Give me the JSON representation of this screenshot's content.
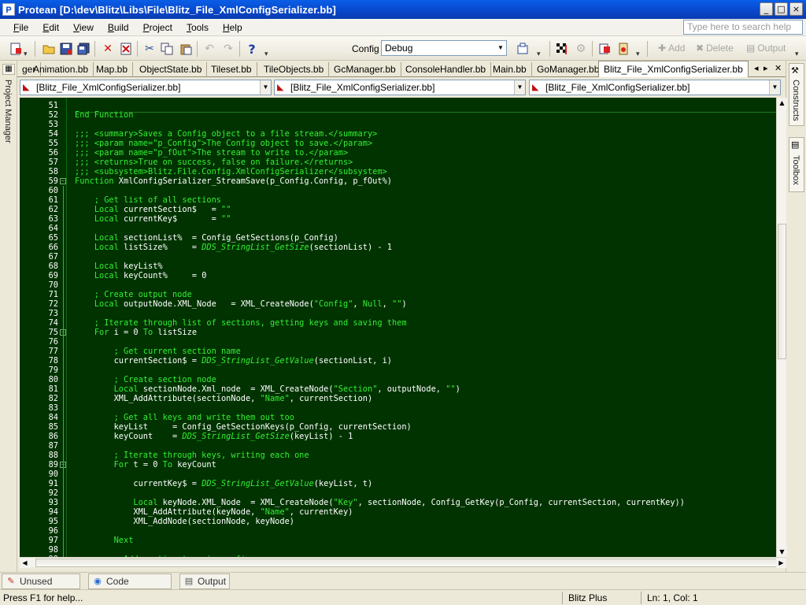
{
  "window": {
    "app_icon": "P",
    "title": "Protean [D:\\dev\\Blitz\\Libs\\File\\Blitz_File_XmlConfigSerializer.bb]",
    "minimize": "_",
    "maximize": "□",
    "close": "×"
  },
  "menu": {
    "items": [
      "File",
      "Edit",
      "View",
      "Build",
      "Project",
      "Tools",
      "Help"
    ],
    "search_placeholder": "Type here to search help"
  },
  "toolbar": {
    "config_label": "Config",
    "config_value": "Debug",
    "add_label": "Add",
    "delete_label": "Delete",
    "output_label": "Output"
  },
  "side": {
    "left_tab": "Project Manager",
    "right_tabs": [
      "Constructs",
      "Toolbox"
    ]
  },
  "tabs": [
    "ger",
    "Animation.bb",
    "Map.bb",
    "ObjectState.bb",
    "Tileset.bb",
    "TileObjects.bb",
    "GcManager.bb",
    "ConsoleHandler.bb",
    "Main.bb",
    "GoManager.bb",
    "Blitz_File_XmlConfigSerializer.bb"
  ],
  "active_tab_index": 10,
  "nav_combos": [
    "[Blitz_File_XmlConfigSerializer.bb]",
    "[Blitz_File_XmlConfigSerializer.bb]",
    "[Blitz_File_XmlConfigSerializer.bb]"
  ],
  "editor": {
    "lines": [
      {
        "n": "51",
        "t": ""
      },
      {
        "n": "52",
        "t": "End Function"
      },
      {
        "n": "53",
        "t": ""
      },
      {
        "n": "54",
        "t": ";;; <summary>Saves a Config object to a file stream.</summary>"
      },
      {
        "n": "55",
        "t": ";;; <param name=\"p_Config\">The Config object to save.</param>"
      },
      {
        "n": "56",
        "t": ";;; <param name=\"p_fOut\">The stream to write to.</param>"
      },
      {
        "n": "57",
        "t": ";;; <returns>True on success, false on failure.</returns>"
      },
      {
        "n": "58",
        "t": ";;; <subsystem>Blitz.File.Config.XmlConfigSerializer</subsystem>"
      },
      {
        "n": "59",
        "t": "Function XmlConfigSerializer_StreamSave(p_Config.Config, p_fOut%)"
      },
      {
        "n": "60",
        "t": ""
      },
      {
        "n": "61",
        "t": "    ; Get list of all sections"
      },
      {
        "n": "62",
        "t": "    Local currentSection$   = \"\""
      },
      {
        "n": "63",
        "t": "    Local currentKey$       = \"\""
      },
      {
        "n": "64",
        "t": ""
      },
      {
        "n": "65",
        "t": "    Local sectionList%  = Config_GetSections(p_Config)"
      },
      {
        "n": "66",
        "t": "    Local listSize%     = DDS_StringList_GetSize(sectionList) - 1"
      },
      {
        "n": "67",
        "t": ""
      },
      {
        "n": "68",
        "t": "    Local keyList%"
      },
      {
        "n": "69",
        "t": "    Local keyCount%     = 0"
      },
      {
        "n": "70",
        "t": ""
      },
      {
        "n": "71",
        "t": "    ; Create output node"
      },
      {
        "n": "72",
        "t": "    Local outputNode.XML_Node   = XML_CreateNode(\"Config\", Null, \"\")"
      },
      {
        "n": "73",
        "t": ""
      },
      {
        "n": "74",
        "t": "    ; Iterate through list of sections, getting keys and saving them"
      },
      {
        "n": "75",
        "t": "    For i = 0 To listSize"
      },
      {
        "n": "76",
        "t": ""
      },
      {
        "n": "77",
        "t": "        ; Get current section name"
      },
      {
        "n": "78",
        "t": "        currentSection$ = DDS_StringList_GetValue(sectionList, i)"
      },
      {
        "n": "79",
        "t": ""
      },
      {
        "n": "80",
        "t": "        ; Create section node"
      },
      {
        "n": "81",
        "t": "        Local sectionNode.Xml_node  = XML_CreateNode(\"Section\", outputNode, \"\")"
      },
      {
        "n": "82",
        "t": "        XML_AddAttribute(sectionNode, \"Name\", currentSection)"
      },
      {
        "n": "83",
        "t": ""
      },
      {
        "n": "84",
        "t": "        ; Get all keys and write them out too"
      },
      {
        "n": "85",
        "t": "        keyList     = Config_GetSectionKeys(p_Config, currentSection)"
      },
      {
        "n": "86",
        "t": "        keyCount    = DDS_StringList_GetSize(keyList) - 1"
      },
      {
        "n": "87",
        "t": ""
      },
      {
        "n": "88",
        "t": "        ; Iterate through keys, writing each one"
      },
      {
        "n": "89",
        "t": "        For t = 0 To keyCount"
      },
      {
        "n": "90",
        "t": ""
      },
      {
        "n": "91",
        "t": "            currentKey$ = DDS_StringList_GetValue(keyList, t)"
      },
      {
        "n": "92",
        "t": ""
      },
      {
        "n": "93",
        "t": "            Local keyNode.XML_Node  = XML_CreateNode(\"Key\", sectionNode, Config_GetKey(p_Config, currentSection, currentKey))"
      },
      {
        "n": "94",
        "t": "            XML_AddAttribute(keyNode, \"Name\", currentKey)"
      },
      {
        "n": "95",
        "t": "            XML_AddNode(sectionNode, keyNode)"
      },
      {
        "n": "96",
        "t": ""
      },
      {
        "n": "97",
        "t": "        Next"
      },
      {
        "n": "98",
        "t": ""
      },
      {
        "n": "99",
        "t": "        ; Add section to main config"
      }
    ],
    "fold_lines": [
      "59",
      "75",
      "89"
    ],
    "colors": {
      "background": "#003300",
      "text": "#ffffff",
      "syntax": "#33ee33"
    }
  },
  "bottom_tabs": [
    {
      "icon": "unused-code-icon",
      "label": "Unused Code"
    },
    {
      "icon": "code-archives-icon",
      "label": "Code Archives"
    },
    {
      "icon": "output-icon",
      "label": "Output"
    }
  ],
  "status": {
    "help": "Press F1 for help...",
    "language": "Blitz Plus",
    "position": "Ln: 1, Col: 1"
  }
}
